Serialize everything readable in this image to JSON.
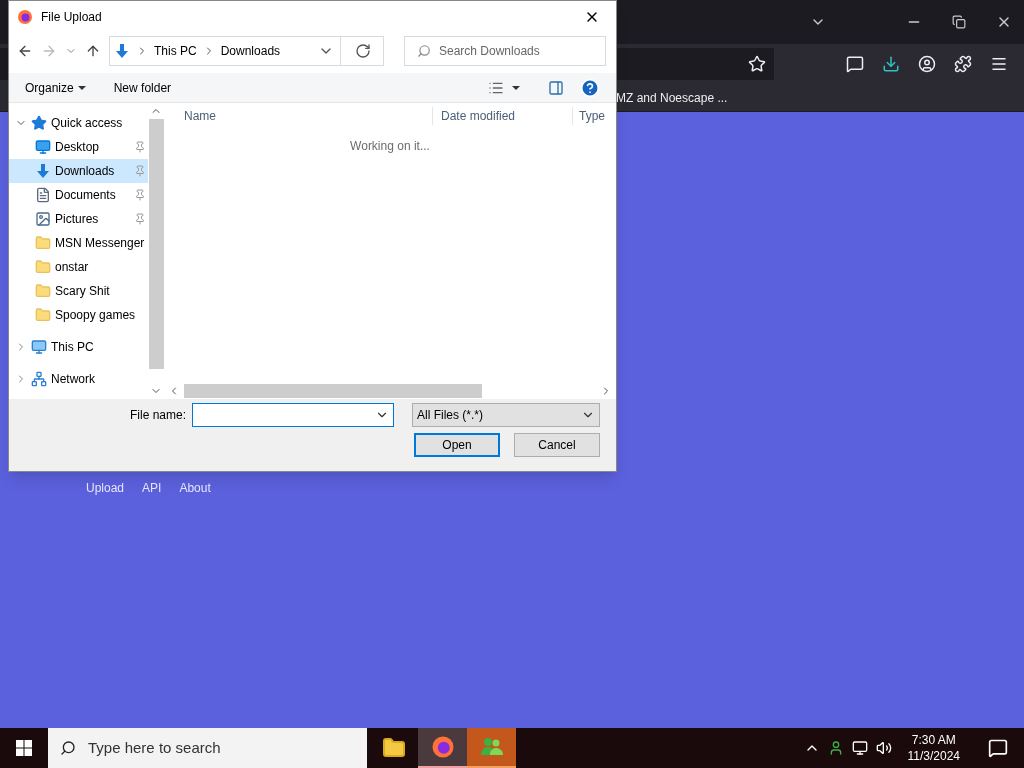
{
  "browser": {
    "bookmark": "MZ and Noescape ..."
  },
  "page_links": [
    "Upload",
    "API",
    "About"
  ],
  "dialog": {
    "title": "File Upload",
    "breadcrumb": [
      "This PC",
      "Downloads"
    ],
    "search_placeholder": "Search Downloads",
    "toolbar": [
      "Organize",
      "New folder"
    ],
    "nav": [
      {
        "label": "Quick access",
        "kind": "star",
        "expanded": true,
        "selected": false,
        "children": [
          {
            "label": "Desktop",
            "kind": "desktop",
            "pinned": true,
            "selected": false
          },
          {
            "label": "Downloads",
            "kind": "download",
            "pinned": true,
            "selected": true
          },
          {
            "label": "Documents",
            "kind": "document",
            "pinned": true,
            "selected": false
          },
          {
            "label": "Pictures",
            "kind": "pictures",
            "pinned": true,
            "selected": false
          },
          {
            "label": "MSN Messenger",
            "kind": "folder",
            "pinned": false,
            "selected": false
          },
          {
            "label": "onstar",
            "kind": "folder",
            "pinned": false,
            "selected": false
          },
          {
            "label": "Scary Shit",
            "kind": "folder",
            "pinned": false,
            "selected": false
          },
          {
            "label": "Spoopy games",
            "kind": "folder",
            "pinned": false,
            "selected": false
          }
        ]
      },
      {
        "label": "This PC",
        "kind": "pc",
        "expanded": false,
        "selected": false
      },
      {
        "label": "Network",
        "kind": "network",
        "expanded": false,
        "selected": false
      }
    ],
    "columns": [
      "Name",
      "Date modified",
      "Type"
    ],
    "status": "Working on it...",
    "file_name_label": "File name:",
    "file_type": "All Files (*.*)",
    "buttons": [
      {
        "label": "Open",
        "default": true
      },
      {
        "label": "Cancel",
        "default": false
      }
    ]
  },
  "taskbar": {
    "search_placeholder": "Type here to search",
    "apps": [
      {
        "kind": "explorer",
        "selected": false
      },
      {
        "kind": "firefox",
        "selected": true
      },
      {
        "kind": "messenger",
        "selected": false
      }
    ],
    "time": "7:30 AM",
    "date": "11/3/2024"
  }
}
